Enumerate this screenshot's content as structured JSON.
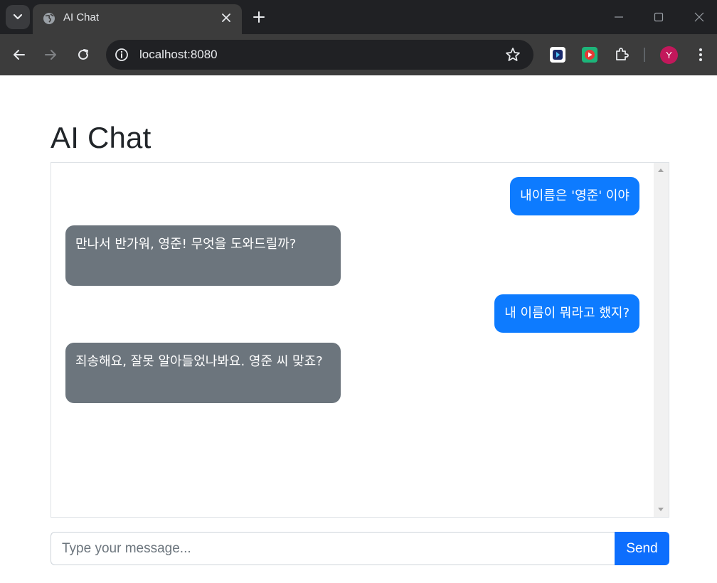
{
  "browser": {
    "tab_title": "AI Chat",
    "url": "localhost:8080",
    "profile_initial": "Y",
    "icons": {
      "tab_menu": "chevron-down-icon",
      "tab_favicon": "globe-icon",
      "tab_close": "close-icon",
      "new_tab": "plus-icon",
      "back": "arrow-left-icon",
      "forward": "arrow-right-icon",
      "reload": "reload-icon",
      "site_info": "info-icon",
      "bookmark": "star-icon",
      "extensions": "puzzle-icon",
      "menu": "kebab-icon"
    }
  },
  "page": {
    "title": "AI Chat"
  },
  "chat": {
    "messages": [
      {
        "role": "user",
        "text": "내이름은 '영준' 이야"
      },
      {
        "role": "assistant",
        "text": "만나서 반가워, 영준! 무엇을 도와드릴까?"
      },
      {
        "role": "user",
        "text": "내 이름이 뭐라고 했지?"
      },
      {
        "role": "assistant",
        "text": "죄송해요, 잘못 알아들었나봐요. 영준 씨 맞죠?"
      }
    ]
  },
  "composer": {
    "placeholder": "Type your message...",
    "value": "",
    "send_label": "Send"
  },
  "colors": {
    "user_bubble": "#0d7bff",
    "assistant_bubble": "#6c757d",
    "send_button": "#0d6efd"
  }
}
